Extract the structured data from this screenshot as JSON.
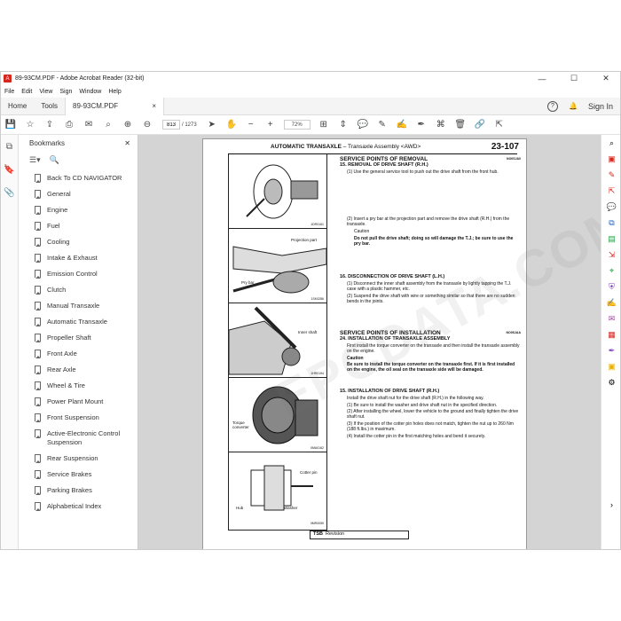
{
  "window": {
    "title": "89-93CM.PDF - Adobe Acrobat Reader (32-bit)",
    "controls": [
      "—",
      "☐",
      "✕"
    ]
  },
  "menu": [
    "File",
    "Edit",
    "View",
    "Sign",
    "Window",
    "Help"
  ],
  "tabs": {
    "home": "Home",
    "tools": "Tools",
    "doc": "89-93CM.PDF",
    "doc_close": "×",
    "sign_in": "Sign In",
    "help": "?"
  },
  "toolbar": {
    "page_current": "813",
    "page_total": "/ 1273",
    "zoom": "72%"
  },
  "bookmarks": {
    "title": "Bookmarks",
    "close": "✕",
    "items": [
      "Back To CD NAVIGATOR",
      "General",
      "Engine",
      "Fuel",
      "Cooling",
      "Intake & Exhaust",
      "Emission Control",
      "Clutch",
      "Manual Transaxle",
      "Automatic Transaxle",
      "Propeller Shaft",
      "Front Axle",
      "Rear Axle",
      "Wheel & Tire",
      "Power Plant Mount",
      "Front Suspension",
      "Active-Electronic Control Suspension",
      "Rear Suspension",
      "Service Brakes",
      "Parking Brakes",
      "Alphabetical Index"
    ]
  },
  "document": {
    "header_main": "AUTOMATIC TRANSAXLE",
    "header_sub": "– Transaxle Assembly <AWD>",
    "page_num": "23-107",
    "watermark": "EPCDATA.COM",
    "figures": [
      {
        "cap": "1DR0161",
        "labels": []
      },
      {
        "cap": "1SK0286",
        "labels": [
          "Projection part",
          "Pry bar"
        ]
      },
      {
        "cap": "1HR0194",
        "labels": [
          "Inner shaft"
        ]
      },
      {
        "cap": "0MA0162",
        "labels": [
          "Torque converter"
        ]
      },
      {
        "cap": "0MR0059",
        "labels": [
          "Cotter pin",
          "Hub",
          "Washer"
        ]
      }
    ],
    "sections": {
      "removal_title": "SERVICE POINTS OF REMOVAL",
      "removal_code": "NO0SJA0",
      "s15": "15. REMOVAL OF DRIVE SHAFT (R.H.)",
      "s15_1": "(1) Use the general service tool to push out the drive shaft from the front hub.",
      "s15_2": "(2) Insert a pry bar at the projection part and remove the drive shaft (R.H.) from the transaxle.",
      "caution1_label": "Caution",
      "caution1": "Do not pull the drive shaft; doing so will damage the T.J.; be sure to use the pry bar.",
      "s16": "16. DISCONNECTION OF DRIVE SHAFT (L.H.)",
      "s16_1": "(1) Disconnect the inner shaft assembly from the transaxle by lightly tapping the T.J. case with a plastic hammer, etc.",
      "s16_2": "(2) Suspend the drive shaft with wire or something similar so that there are no sudden bends in the joints.",
      "install_title": "SERVICE POINTS OF INSTALLATION",
      "install_code": "NO0SJAA",
      "s24": "24. INSTALLATION OF TRANSAXLE ASSEMBLY",
      "s24_1": "First install the torque converter on the transaxle and then install the transaxle assembly on the engine.",
      "caution2_label": "Caution",
      "caution2": "Be sure to install the torque converter on the transaxle first. If it is first installed on the engine, the oil seal on the transaxle side will be damaged.",
      "s15b": "15. INSTALLATION OF DRIVE SHAFT (R.H.)",
      "s15b_0": "Install the drive shaft nut for the drive shaft (R.H.) in the following way.",
      "s15b_1": "(1) Be sure to install the washer and drive shaft nut in the specified direction.",
      "s15b_2": "(2) After installing the wheel, lower the vehicle to the ground and finally tighten the drive shaft nut.",
      "s15b_3": "(3) If the position of the cotter pin holes does not match, tighten the nut up to 260 Nm (188 ft.lbs.) in maximum.",
      "s15b_4": "(4) Install the cotter pin in the first matching holes and bend it securely.",
      "tsb_label": "TSB",
      "tsb_text": "Revision"
    }
  }
}
